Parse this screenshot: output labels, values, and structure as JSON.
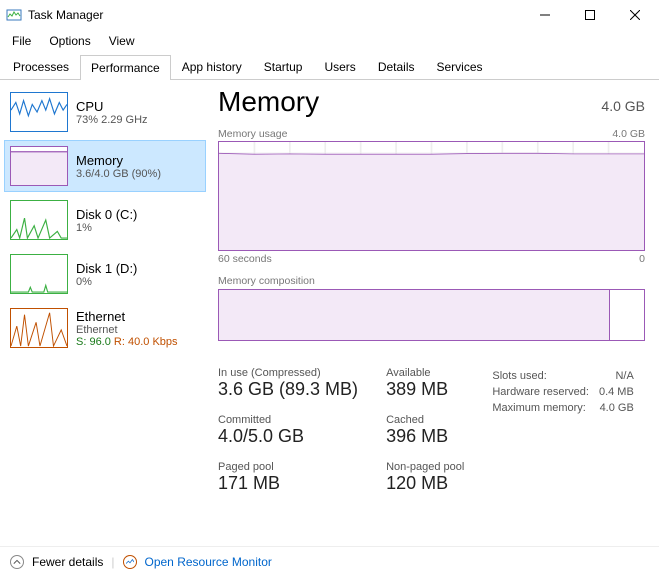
{
  "window": {
    "title": "Task Manager"
  },
  "menu": {
    "file": "File",
    "options": "Options",
    "view": "View"
  },
  "tabs": {
    "processes": "Processes",
    "performance": "Performance",
    "app_history": "App history",
    "startup": "Startup",
    "users": "Users",
    "details": "Details",
    "services": "Services"
  },
  "sidebar": {
    "cpu": {
      "title": "CPU",
      "sub": "73%  2.29 GHz"
    },
    "memory": {
      "title": "Memory",
      "sub": "3.6/4.0 GB (90%)"
    },
    "disk0": {
      "title": "Disk 0 (C:)",
      "sub": "1%"
    },
    "disk1": {
      "title": "Disk 1 (D:)",
      "sub": "0%"
    },
    "ethernet": {
      "title": "Ethernet",
      "sub1": "Ethernet",
      "send": "S: 96.0",
      "recv": "R: 40.0 Kbps"
    }
  },
  "main": {
    "heading": "Memory",
    "capacity": "4.0 GB",
    "chart_usage_label": "Memory usage",
    "chart_usage_max": "4.0 GB",
    "axis_left": "60 seconds",
    "axis_right": "0",
    "composition_label": "Memory composition",
    "stats": {
      "in_use_lbl": "In use (Compressed)",
      "in_use_val": "3.6 GB (89.3 MB)",
      "available_lbl": "Available",
      "available_val": "389 MB",
      "committed_lbl": "Committed",
      "committed_val": "4.0/5.0 GB",
      "cached_lbl": "Cached",
      "cached_val": "396 MB",
      "paged_lbl": "Paged pool",
      "paged_val": "171 MB",
      "nonpaged_lbl": "Non-paged pool",
      "nonpaged_val": "120 MB"
    },
    "right_stats": {
      "slots_lbl": "Slots used:",
      "slots_val": "N/A",
      "hw_lbl": "Hardware reserved:",
      "hw_val": "0.4 MB",
      "max_lbl": "Maximum memory:",
      "max_val": "4.0 GB"
    }
  },
  "footer": {
    "fewer": "Fewer details",
    "resmon": "Open Resource Monitor"
  },
  "chart_data": {
    "type": "line",
    "title": "Memory usage",
    "xlabel": "60 seconds → 0",
    "ylabel": "GB",
    "ylim": [
      0,
      4.0
    ],
    "x_seconds": [
      60,
      55,
      50,
      45,
      40,
      35,
      30,
      25,
      20,
      15,
      10,
      5,
      0
    ],
    "values": [
      3.58,
      3.55,
      3.56,
      3.55,
      3.55,
      3.55,
      3.55,
      3.57,
      3.58,
      3.58,
      3.56,
      3.56,
      3.56
    ],
    "composition_fraction_in_use": 0.92
  }
}
